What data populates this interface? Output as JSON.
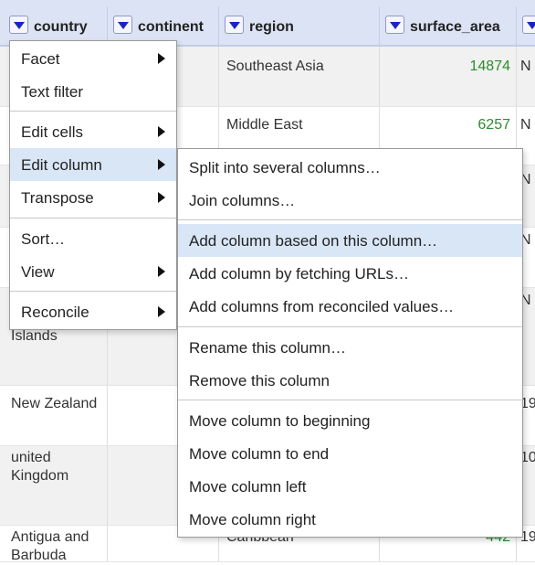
{
  "columns": [
    {
      "name": "country"
    },
    {
      "name": "continent"
    },
    {
      "name": "region"
    },
    {
      "name": "surface_area"
    }
  ],
  "rows": [
    {
      "country": "",
      "region": "Southeast Asia",
      "surface_area": "14874",
      "extra": "N"
    },
    {
      "country": "",
      "region": "Middle East",
      "surface_area": "6257",
      "extra": "N"
    },
    {
      "country": "",
      "region": "",
      "surface_area": "",
      "extra": "N"
    },
    {
      "country": "",
      "region": "",
      "surface_area": "",
      "extra": "N"
    },
    {
      "country": "Islands",
      "region": "",
      "surface_area": "",
      "extra": "N"
    },
    {
      "country": "New Zealand",
      "region": "",
      "surface_area": "",
      "extra": "19"
    },
    {
      "country": "united Kingdom",
      "region": "",
      "surface_area": "",
      "extra": "10"
    },
    {
      "country": "Antigua and Barbuda",
      "region": "Caribbean",
      "surface_area": "442",
      "extra": "19"
    }
  ],
  "column_menu": {
    "items": [
      {
        "label": "Facet",
        "submenu": true
      },
      {
        "label": "Text filter",
        "submenu": false
      },
      {
        "label": "Edit cells",
        "submenu": true
      },
      {
        "label": "Edit column",
        "submenu": true,
        "highlighted": true
      },
      {
        "label": "Transpose",
        "submenu": true
      },
      {
        "label": "Sort…",
        "submenu": false
      },
      {
        "label": "View",
        "submenu": true
      },
      {
        "label": "Reconcile",
        "submenu": true
      }
    ]
  },
  "edit_column_menu": {
    "items": [
      {
        "label": "Split into several columns…"
      },
      {
        "label": "Join columns…"
      },
      {
        "label": "Add column based on this column…",
        "highlighted": true
      },
      {
        "label": "Add column by fetching URLs…"
      },
      {
        "label": "Add columns from reconciled values…"
      },
      {
        "label": "Rename this column…"
      },
      {
        "label": "Remove this column"
      },
      {
        "label": "Move column to beginning"
      },
      {
        "label": "Move column to end"
      },
      {
        "label": "Move column left"
      },
      {
        "label": "Move column right"
      }
    ]
  }
}
